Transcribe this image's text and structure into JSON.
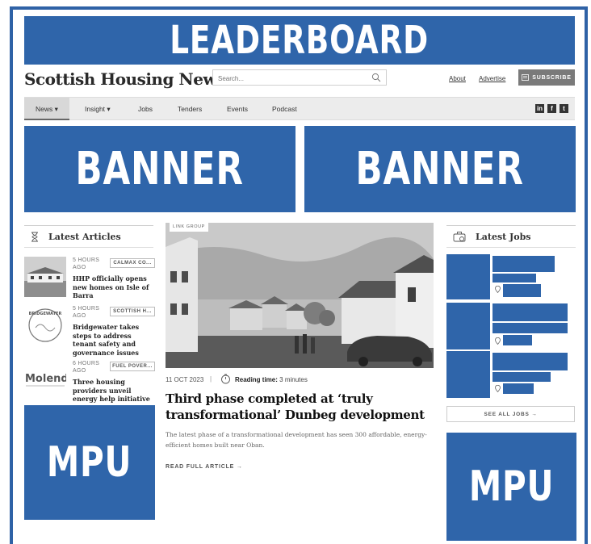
{
  "ads": {
    "leaderboard": "LEADERBOARD",
    "banner_left": "BANNER",
    "banner_right": "BANNER",
    "mpu_left": "MPU",
    "mpu_right": "MPU"
  },
  "header": {
    "site_title": "Scottish Housing News",
    "search_placeholder": "Search...",
    "about": "About",
    "advertise": "Advertise",
    "subscribe": "SUBSCRIBE"
  },
  "nav": {
    "items": [
      {
        "label": "News ▾"
      },
      {
        "label": "Insight ▾"
      },
      {
        "label": "Jobs"
      },
      {
        "label": "Tenders"
      },
      {
        "label": "Events"
      },
      {
        "label": "Podcast"
      }
    ],
    "social": [
      "in",
      "f",
      "t"
    ]
  },
  "latest_articles": {
    "title": "Latest Articles",
    "items": [
      {
        "time": "5 HOURS AGO",
        "tag": "CALMAX CO...",
        "headline": "HHP officially opens new homes on Isle of Barra"
      },
      {
        "time": "5 HOURS AGO",
        "tag": "SCOTTISH H...",
        "headline": "Bridgewater takes steps to address tenant safety and governance issues"
      },
      {
        "time": "6 HOURS AGO",
        "tag": "FUEL POVER...",
        "headline": "Three housing providers unveil energy help initiative"
      }
    ],
    "thumb_texts": [
      "BRIDGEWATER",
      "Molend"
    ]
  },
  "main_article": {
    "tag": "LINK GROUP",
    "date": "11 OCT 2023",
    "separator": "|",
    "reading_label": "Reading time:",
    "reading_value": "3 minutes",
    "headline": "Third phase completed at ‘truly transformational’ Dunbeg development",
    "summary": "The latest phase of a transformational development has seen 300 affordable, energy-efficient homes built near Oban.",
    "read_more": "READ FULL ARTICLE →"
  },
  "latest_jobs": {
    "title": "Latest Jobs",
    "see_all": "SEE ALL JOBS →"
  },
  "colors": {
    "ad_blue": "#2f65aa",
    "frame_blue": "#2f62a6"
  }
}
